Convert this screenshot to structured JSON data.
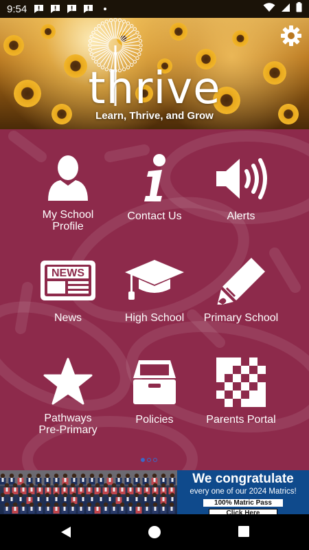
{
  "status_bar": {
    "time": "9:54"
  },
  "header": {
    "brand": "thrive",
    "tagline": "Learn, Thrive, and Grow"
  },
  "tiles": [
    {
      "label": "My School\nProfile",
      "icon": "person-icon"
    },
    {
      "label": "Contact Us",
      "icon": "info-icon"
    },
    {
      "label": "Alerts",
      "icon": "speaker-icon"
    },
    {
      "label": "News",
      "icon": "newspaper-icon"
    },
    {
      "label": "High School",
      "icon": "graduation-cap-icon"
    },
    {
      "label": "Primary School",
      "icon": "pencil-icon"
    },
    {
      "label": "Pathways\nPre-Primary",
      "icon": "star-icon"
    },
    {
      "label": "Policies",
      "icon": "file-box-icon"
    },
    {
      "label": "Parents Portal",
      "icon": "checkerboard-icon"
    }
  ],
  "news_icon_text": "NEWS",
  "pager": {
    "pages": 3,
    "current": 1
  },
  "banner": {
    "title": "We congratulate",
    "subtitle": "every one of our 2024 Matrics!",
    "badge": "100% Matric Pass",
    "cta": "Click Here"
  },
  "colors": {
    "main_bg": "#8d2a4b",
    "banner_bg": "#0f4a8c",
    "pager": "#3a69c9"
  }
}
